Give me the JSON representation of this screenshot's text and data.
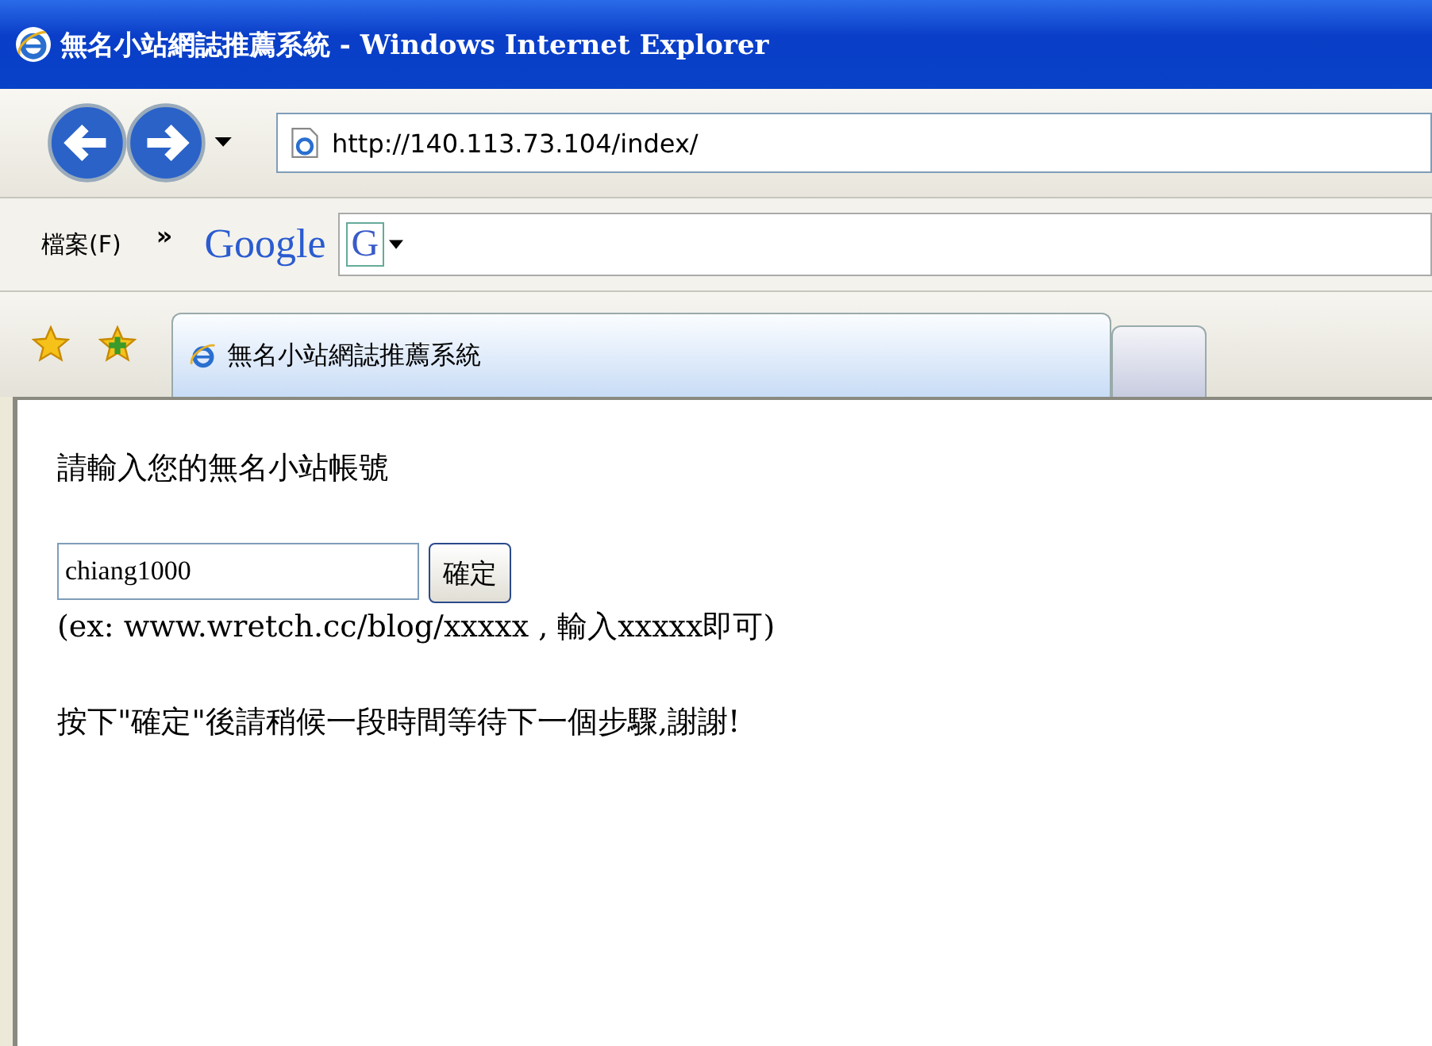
{
  "window": {
    "title": "無名小站網誌推薦系統 - Windows Internet Explorer"
  },
  "address_bar": {
    "url": "http://140.113.73.104/index/"
  },
  "menu": {
    "label": "檔案(F)",
    "chevron": "»"
  },
  "google_toolbar": {
    "logo": "Google",
    "button": "G"
  },
  "tabs": [
    {
      "label": "無名小站網誌推薦系統",
      "selected": true
    }
  ],
  "page": {
    "heading": "請輸入您的無名小站帳號",
    "account_field": {
      "value": "chiang1000"
    },
    "submit": "確定",
    "hint": "(ex: www.wretch.cc/blog/xxxxx , 輸入xxxxx即可)",
    "notice": "按下\"確定\"後請稍候一段時間等待下一個步驟,謝謝!"
  }
}
